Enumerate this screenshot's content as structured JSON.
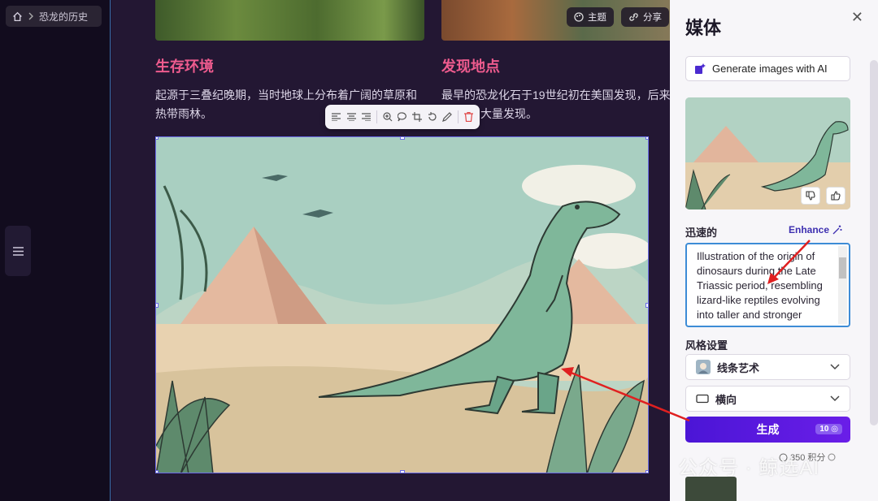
{
  "breadcrumb": {
    "page": "恐龙的历史"
  },
  "topbar": {
    "theme_label": "主题",
    "share_label": "分享"
  },
  "sections": [
    {
      "heading": "生存环境",
      "text_line1": "起源于三叠纪晚期，当时地球上分布着广阔的草原和",
      "text_line2": "热带雨林。"
    },
    {
      "heading": "发现地点",
      "text_line1": "最早的恐龙化石于19世纪初在美国发现，后来",
      "text_line2": "大量发现。"
    }
  ],
  "panel": {
    "title": "媒体",
    "generate_images_label": "Generate images with AI",
    "prompt_label": "迅速的",
    "enhance_label": "Enhance",
    "prompt_text": "Illustration of the origin of dinosaurs during the Late Triassic period, resembling lizard-like reptiles evolving into taller and stronger creatures",
    "style_label": "风格设置",
    "style_value": "线条艺术",
    "orientation_value": "横向",
    "generate_label": "生成",
    "generate_cost": "10",
    "credits": "350 积分"
  },
  "watermark": "公众号 · 鲸选AI",
  "colors": {
    "accent": "#5a1ae0",
    "heading": "#ee5b8e",
    "selection": "#6a6ce8"
  }
}
